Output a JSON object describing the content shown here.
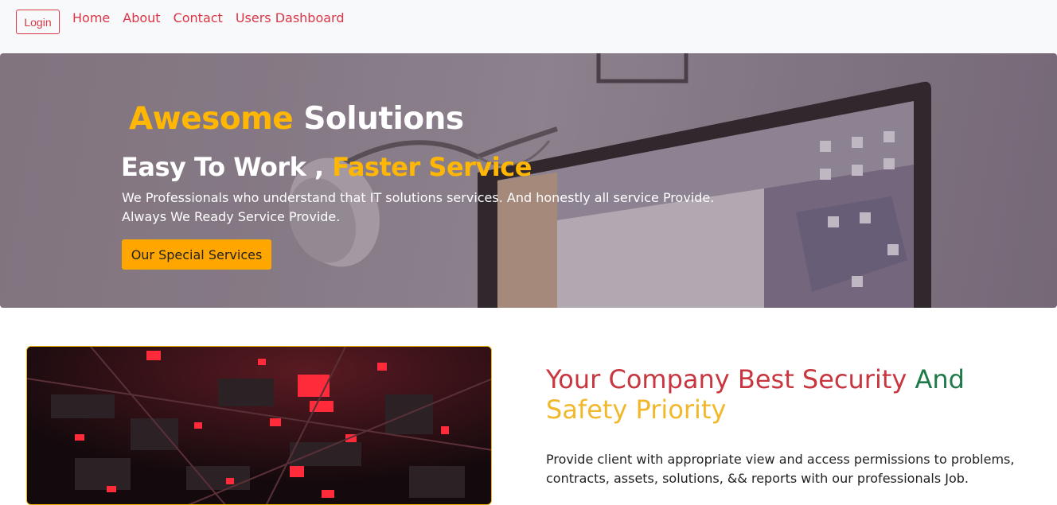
{
  "navbar": {
    "login_label": "Login",
    "links": [
      "Home",
      "About",
      "Contact",
      "Users Dashboard"
    ]
  },
  "hero": {
    "title_part1": "Awesome",
    "title_part2": "Solutions",
    "subtitle_part1": "Easy To Work ,",
    "subtitle_part2": "Faster Service",
    "description_line1": "We Professionals who understand that IT solutions services. And honestly all service Provide.",
    "description_line2": "Always We Ready Service Provide.",
    "button_label": "Our Special Services"
  },
  "feature": {
    "heading_part1": "Your Company Best Security",
    "heading_part2": "And",
    "heading_part3": "Safety Priority",
    "text": "Provide client with appropriate view and access permissions to problems, contracts, assets, solutions, && reports with our professionals Job."
  },
  "colors": {
    "accent_red": "#dc3545",
    "accent_yellow": "#ffb703",
    "button_orange": "#ffa600",
    "heading_green": "#1e7a48"
  }
}
